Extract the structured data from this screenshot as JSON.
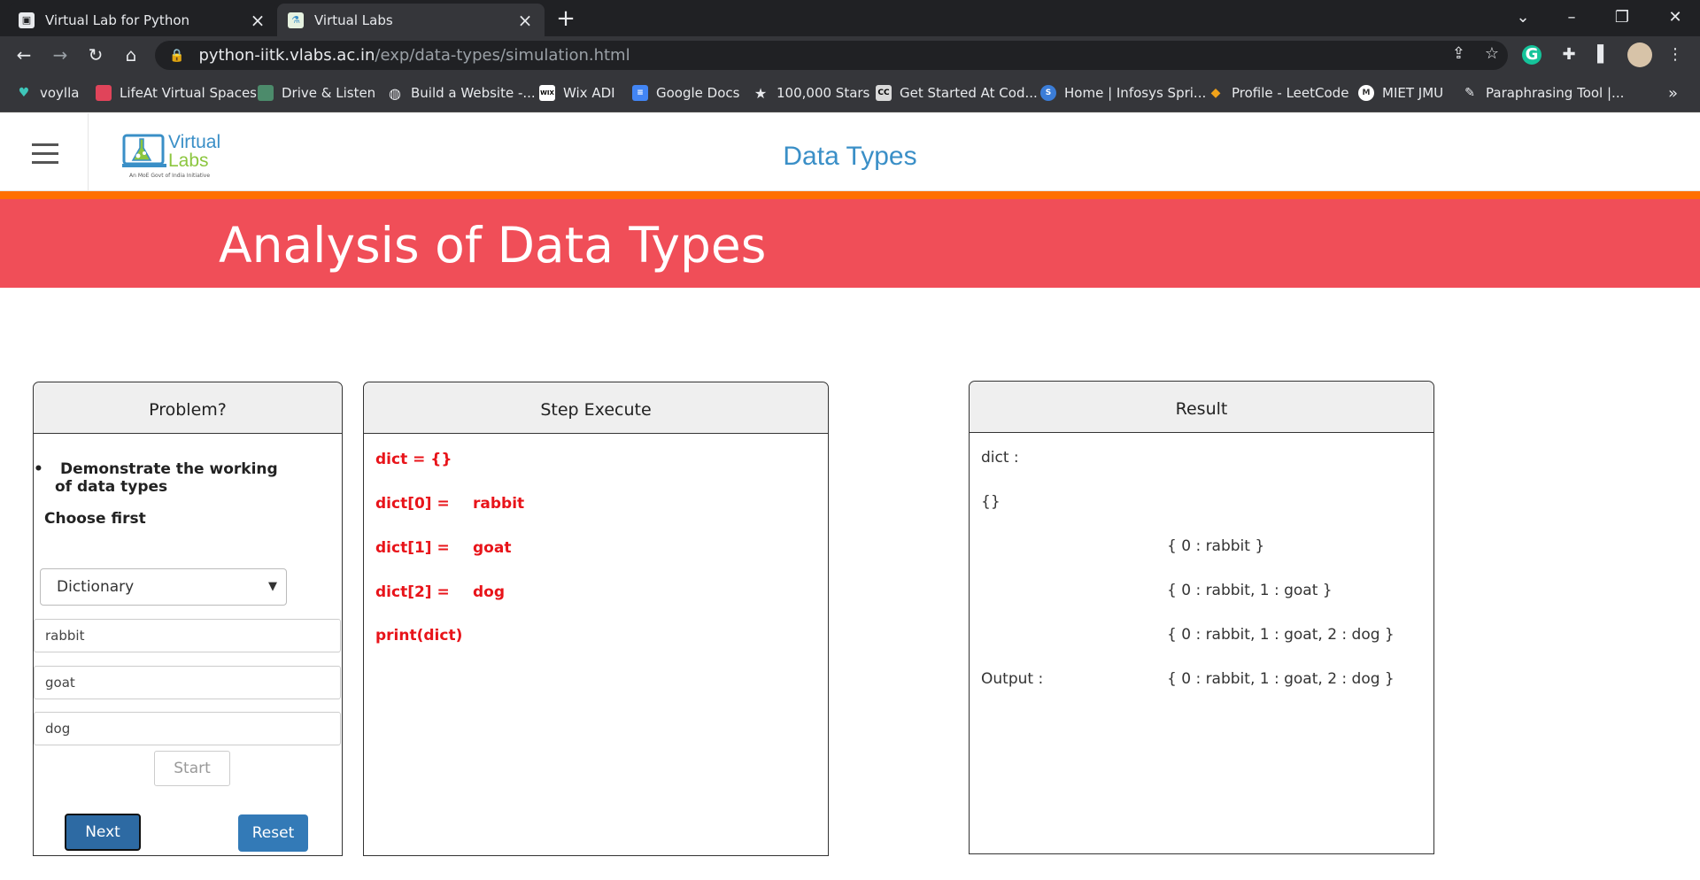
{
  "browser": {
    "tabs": [
      {
        "title": "Virtual Lab for Python",
        "active": false
      },
      {
        "title": "Virtual Labs",
        "active": true
      }
    ],
    "url_host": "python-iitk.vlabs.ac.in",
    "url_path": "/exp/data-types/simulation.html",
    "bookmarks": [
      {
        "label": "voylla",
        "icon": "voylla-icon",
        "color": "#3ec6b9"
      },
      {
        "label": "LifeAt Virtual Spaces",
        "icon": "lifeat-icon",
        "color": "#e0445a"
      },
      {
        "label": "Drive & Listen",
        "icon": "drive-listen-icon",
        "color": "#4c8b6b"
      },
      {
        "label": "Build a Website -...",
        "icon": "globe-icon",
        "color": "#e8eaed"
      },
      {
        "label": "Wix ADI",
        "icon": "wix-icon",
        "color": "#ffffff"
      },
      {
        "label": "Google Docs",
        "icon": "docs-icon",
        "color": "#4285f4"
      },
      {
        "label": "100,000 Stars",
        "icon": "star-icon",
        "color": "#e8eaed"
      },
      {
        "label": "Get Started At Cod...",
        "icon": "cc-icon",
        "color": "#d9d9d9"
      },
      {
        "label": "Home | Infosys Spri...",
        "icon": "infosys-icon",
        "color": "#3b7dd8"
      },
      {
        "label": "Profile - LeetCode",
        "icon": "leetcode-icon",
        "color": "#f0a21a"
      },
      {
        "label": "MIET JMU",
        "icon": "miet-icon",
        "color": "#ffffff"
      },
      {
        "label": "Paraphrasing Tool |...",
        "icon": "quill-icon",
        "color": "#e8eaed"
      }
    ]
  },
  "header": {
    "title": "Data Types",
    "logo_text": "Virtual",
    "logo_text2": "Labs",
    "logo_tagline": "An MoE Govt of India Initiative"
  },
  "banner": {
    "title": "Analysis of Data Types"
  },
  "problem": {
    "heading": "Problem?",
    "bullet": "Demonstrate the working of data types",
    "choose": "Choose first",
    "selected_type": "Dictionary",
    "inputs": [
      "rabbit",
      "goat",
      "dog"
    ],
    "start_label": "Start",
    "next_label": "Next",
    "reset_label": "Reset"
  },
  "step": {
    "heading": "Step Execute",
    "lines": [
      {
        "code": "dict = {}",
        "value": ""
      },
      {
        "code": "dict[0] =",
        "value": "rabbit"
      },
      {
        "code": "dict[1] =",
        "value": "goat"
      },
      {
        "code": "dict[2] =",
        "value": "dog"
      },
      {
        "code": "print(dict)",
        "value": ""
      }
    ]
  },
  "result": {
    "heading": "Result",
    "rows": [
      {
        "label": "dict :",
        "value": ""
      },
      {
        "label": "{}",
        "value": ""
      },
      {
        "label": "",
        "value": "{ 0 : rabbit }"
      },
      {
        "label": "",
        "value": "{ 0 : rabbit, 1 : goat }"
      },
      {
        "label": "",
        "value": "{ 0 : rabbit, 1 : goat, 2 : dog }"
      },
      {
        "label": "Output :",
        "value": "{ 0 : rabbit, 1 : goat, 2 : dog }"
      }
    ]
  }
}
